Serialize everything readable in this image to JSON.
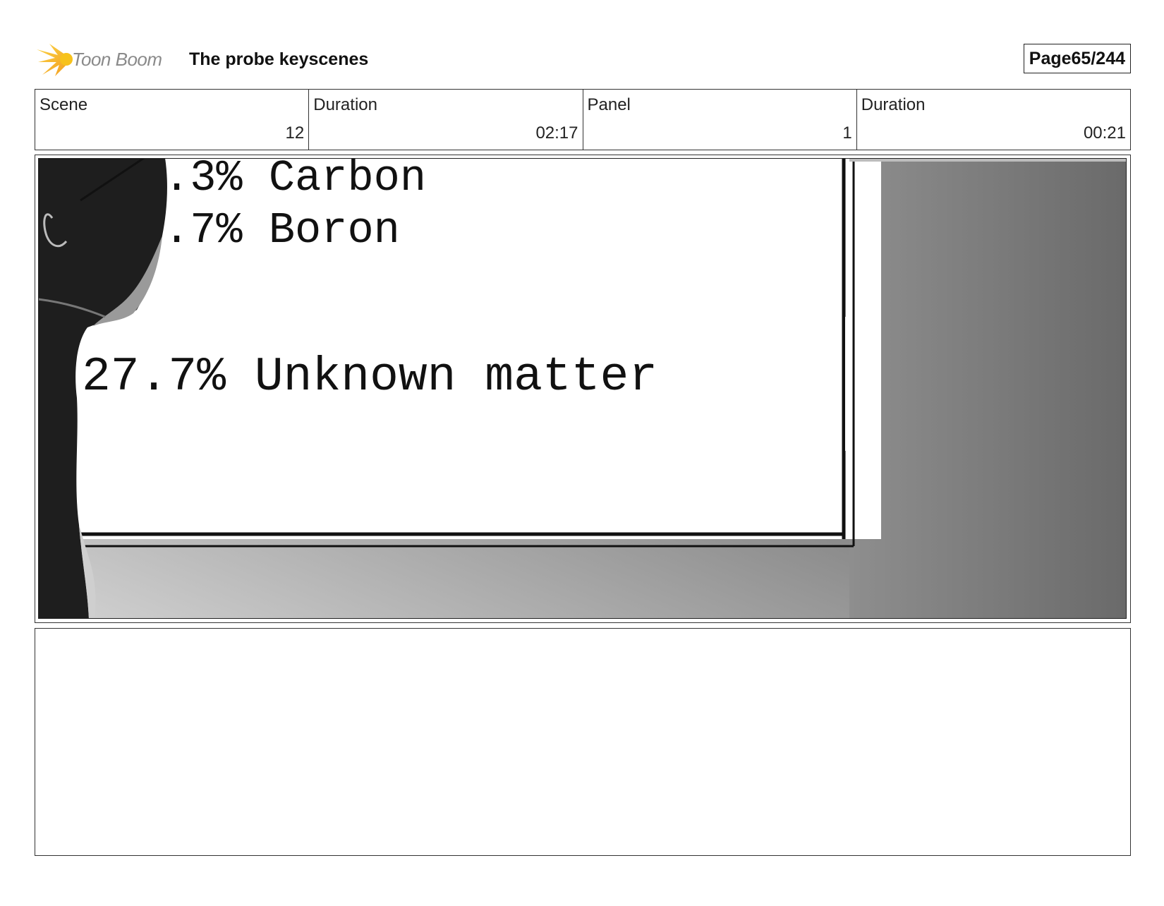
{
  "header": {
    "logo_text": "Toon Boom",
    "title": "The probe keyscenes",
    "page_label": "Page",
    "page_value": "65/244"
  },
  "info": {
    "scene_label": "Scene",
    "scene_value": "12",
    "scene_duration_label": "Duration",
    "scene_duration_value": "02:17",
    "panel_label": "Panel",
    "panel_value": "1",
    "panel_duration_label": "Duration",
    "panel_duration_value": "00:21"
  },
  "panel": {
    "lines": [
      ".3% Carbon",
      ".7% Boron",
      "27.7% Unknown matter"
    ]
  },
  "colors": {
    "logo_yellow": "#f7c21b",
    "logo_orange": "#f39a1e",
    "border": "#333333"
  }
}
